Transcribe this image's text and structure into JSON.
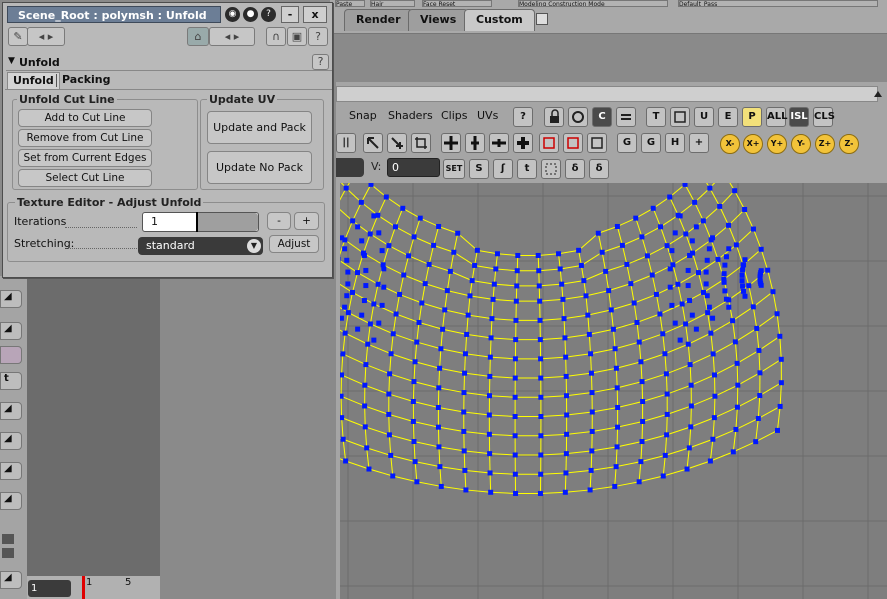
{
  "window": {
    "title": "Scene_Root : polymsh : Unfold",
    "minimize_label": "-",
    "close_label": "x",
    "help_label": "?"
  },
  "section": {
    "title": "Unfold",
    "help_label": "?"
  },
  "tabs": [
    {
      "label": "Unfold",
      "active": true
    },
    {
      "label": "Packing",
      "active": false
    }
  ],
  "cut_line": {
    "group_label": "Unfold Cut Line",
    "buttons": [
      "Add to Cut Line",
      "Remove from Cut Line",
      "Set from Current Edges",
      "Select Cut Line"
    ]
  },
  "update_uv": {
    "group_label": "Update UV",
    "buttons": [
      "Update and Pack",
      "Update No Pack"
    ]
  },
  "texture_editor": {
    "group_label": "Texture Editor - Adjust Unfold",
    "iterations_label": "Iterations",
    "iterations_value": "1",
    "iterations_slider_fraction": 0.46,
    "minus_label": "-",
    "plus_label": "+",
    "stretching_label": "Stretching:",
    "stretching_value": "standard",
    "adjust_label": "Adjust"
  },
  "top_tabs": [
    "Render",
    "Views",
    "Custom"
  ],
  "active_top_tab": "Custom",
  "top_hints": [
    "Paste",
    "Hair",
    "Face Reset",
    "Modeling Construction Mode",
    "Default_Pass"
  ],
  "uv_menu": [
    "Snap",
    "Shaders",
    "Clips",
    "UVs"
  ],
  "uv_toolbar": {
    "help_label": "?",
    "text_buttons": [
      "T",
      "ALL",
      "ISL",
      "CLS"
    ],
    "axis_buttons": [
      "X-",
      "X+",
      "Y+",
      "Y-",
      "Z+",
      "Z-"
    ],
    "set_label": "SET",
    "v_label": "V:",
    "v_value": "0"
  },
  "left_strip": {
    "labels": [
      "t"
    ]
  },
  "timeline": {
    "frame_value": "1",
    "tick_labels": [
      "1",
      "5"
    ]
  },
  "colors": {
    "title_bar": "#6c7e96",
    "mesh_edge": "#ffff00",
    "mesh_vertex": "#0018ff",
    "viewport_bg": "#7e7e7e",
    "timeline_marker": "#e00000"
  },
  "icons": [
    "window-icon",
    "camera-icon",
    "help-icon",
    "lock-icon",
    "pin-icon",
    "grid-icon",
    "arrow-icon",
    "move-icon",
    "scale-icon"
  ]
}
